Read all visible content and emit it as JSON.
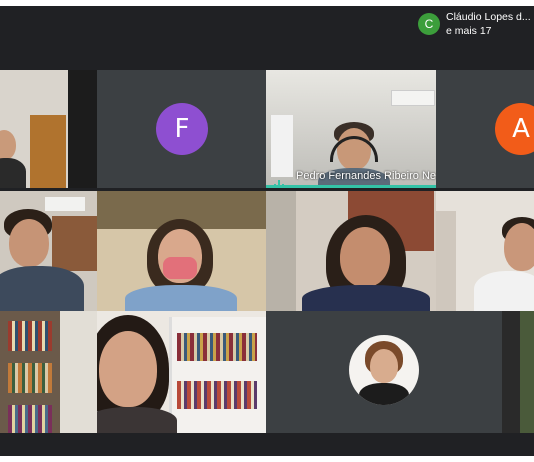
{
  "participants_chip": {
    "avatar_letter": "C",
    "name": "Cláudio Lopes d...",
    "more": "e mais 17"
  },
  "tiles": [
    {
      "id": "r1c1",
      "type": "video"
    },
    {
      "id": "r1c2",
      "type": "avatar",
      "letter": "F",
      "color": "#8e4fd1"
    },
    {
      "id": "r1c3",
      "type": "video",
      "name": "Pedro Fernandes Ribeiro Ne..."
    },
    {
      "id": "r1c4",
      "type": "avatar",
      "letter": "A",
      "color": "#f25c19"
    },
    {
      "id": "r2c1",
      "type": "video"
    },
    {
      "id": "r2c2",
      "type": "video"
    },
    {
      "id": "r2c3",
      "type": "video"
    },
    {
      "id": "r2c4",
      "type": "video"
    },
    {
      "id": "r3c1",
      "type": "video"
    },
    {
      "id": "r3c2",
      "type": "video"
    },
    {
      "id": "r3c3",
      "type": "photo"
    },
    {
      "id": "r3c4",
      "type": "video"
    }
  ],
  "colors": {
    "background": "#202124",
    "speaking_indicator": "#34c3a7"
  }
}
